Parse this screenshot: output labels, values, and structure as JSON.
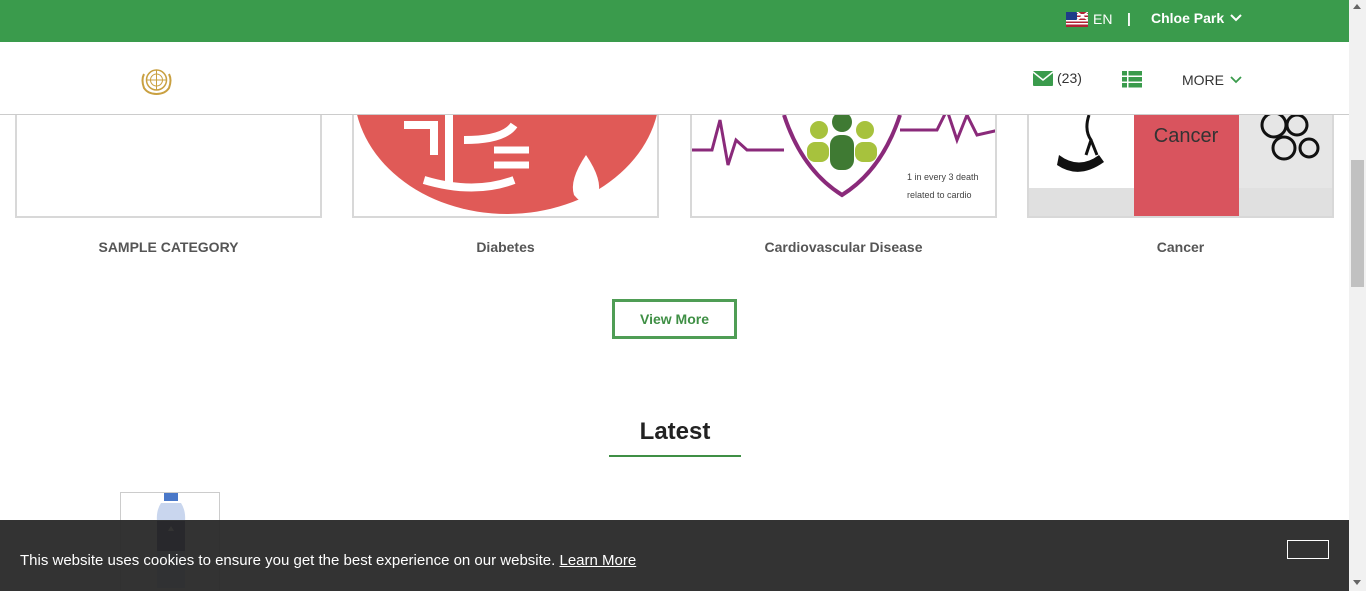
{
  "topbar": {
    "language": "EN",
    "separator": "|",
    "user_name": "Chloe Park"
  },
  "navbar": {
    "message_count": "(23)",
    "more_label": "MORE"
  },
  "categories": [
    {
      "label": "SAMPLE CATEGORY"
    },
    {
      "label": "Diabetes"
    },
    {
      "label": "Cardiovascular Disease",
      "image_text": [
        "1 in every 3 death",
        "related to cardio"
      ]
    },
    {
      "label": "Cancer",
      "image_text": "Cancer"
    }
  ],
  "view_more_label": "View More",
  "latest_heading": "Latest",
  "cookie": {
    "message": "This website uses cookies to ensure you get the best experience on our website.",
    "link_text": "Learn More"
  },
  "colors": {
    "brand_green": "#3a9b4c",
    "diabetes_red": "#e05a57",
    "cancer_red": "#d9545e",
    "cardio_purple": "#8a2a7a"
  }
}
